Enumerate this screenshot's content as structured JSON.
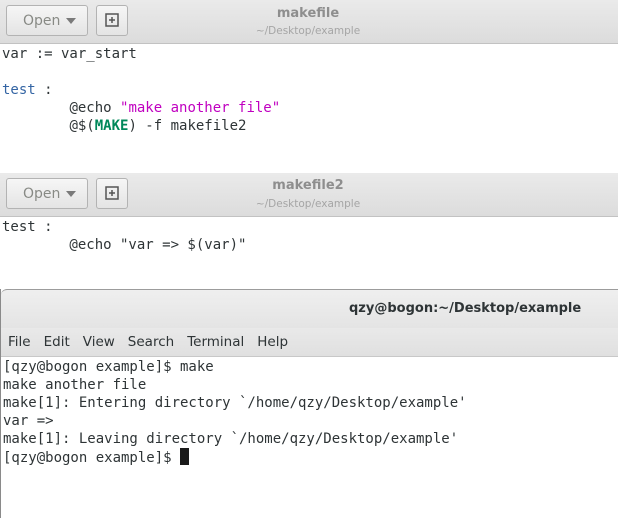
{
  "editors": [
    {
      "open_label": "Open",
      "title": "makefile",
      "subtitle": "~/Desktop/example",
      "lines": {
        "l1": "var := var_start",
        "l3_target": "test",
        "l3_rest": " :",
        "l4_indent": "        ",
        "l4_cmd": "@echo ",
        "l4_str": "\"make another file\"",
        "l5_indent": "        ",
        "l5_pre": "@$(",
        "l5_var": "MAKE",
        "l5_post": ") -f makefile2"
      }
    },
    {
      "open_label": "Open",
      "title": "makefile2",
      "subtitle": "~/Desktop/example",
      "lines": {
        "l1": "test :",
        "l2": "        @echo \"var => $(var)\""
      }
    }
  ],
  "terminal": {
    "title": "qzy@bogon:~/Desktop/example",
    "menu": [
      "File",
      "Edit",
      "View",
      "Search",
      "Terminal",
      "Help"
    ],
    "output": [
      "[qzy@bogon example]$ make",
      "make another file",
      "make[1]: Entering directory `/home/qzy/Desktop/example'",
      "var =>",
      "make[1]: Leaving directory `/home/qzy/Desktop/example'"
    ],
    "prompt": "[qzy@bogon example]$ "
  },
  "colors": {
    "target": "#3465a4",
    "string": "#c000c0",
    "variable": "#00885a"
  },
  "icons": {
    "open_dropdown": "chevron-down-icon",
    "new_document": "new-document-icon"
  }
}
